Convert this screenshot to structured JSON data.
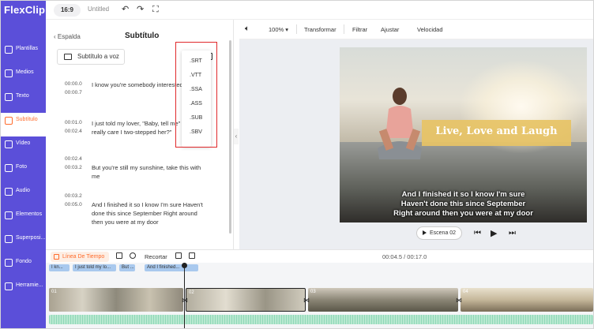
{
  "app": {
    "logo": "FlexClip"
  },
  "sidebar": {
    "items": [
      {
        "label": "Plantillas",
        "icon": "template-icon"
      },
      {
        "label": "Medios",
        "icon": "media-icon"
      },
      {
        "label": "Texto",
        "icon": "text-icon"
      },
      {
        "label": "Subtítulo",
        "icon": "subtitle-icon",
        "active": true
      },
      {
        "label": "Vídeo",
        "icon": "video-icon"
      },
      {
        "label": "Foto",
        "icon": "photo-icon"
      },
      {
        "label": "Audio",
        "icon": "audio-icon"
      },
      {
        "label": "Elementos",
        "icon": "elements-icon"
      },
      {
        "label": "Superposi...",
        "icon": "overlay-icon"
      },
      {
        "label": "Fondo",
        "icon": "background-icon"
      },
      {
        "label": "Herramie...",
        "icon": "tools-icon"
      }
    ]
  },
  "topbar": {
    "ratio": "16:9",
    "title": "Untitled"
  },
  "panel": {
    "back_label": "Espalda",
    "title": "Subtítulo",
    "tts_label": "Subtítulo a voz",
    "rows": [
      {
        "start": "00:00.0",
        "end": "00:00.7",
        "text": "I know you're somebody interested n'"
      },
      {
        "start": "00:01.0",
        "end": "00:02.4",
        "text": "I just told my lover, \"Baby, tell me\" \"Did you really care I two-stepped her?\""
      },
      {
        "start": "00:02.4",
        "end": "00:03.2",
        "text": "But you're still my sunshine, take this with me"
      },
      {
        "start": "00:03.2",
        "end": "00:05.0",
        "text": "And I finished it so I know I'm sure Haven't done this since September Right around then you were at my door"
      }
    ]
  },
  "dropdown": {
    "options": [
      ".SRT",
      ".VTT",
      ".SSA",
      ".ASS",
      ".SUB",
      ".SBV"
    ]
  },
  "toolbar": {
    "zoom": "100%",
    "transform": "Transformar",
    "filter": "Filtrar",
    "adjust": "Ajustar",
    "speed": "Velocidad"
  },
  "canvas": {
    "title_text": "Live, Love and Laugh",
    "caption_lines": [
      "And I finished it so I know I'm sure",
      "Haven't done this since September",
      "Right around then you were at my door"
    ],
    "scene_label": "Escena 02"
  },
  "timeline": {
    "label": "Línea De Tiempo",
    "crop_label": "Recortar",
    "time": "00:04.5 / 00:17.0",
    "subtitle_pills": [
      "I kn...",
      "I just told my lo...",
      "But ...",
      "And I finished..."
    ],
    "clip_numbers": [
      "01",
      "02",
      "03",
      "04"
    ]
  },
  "colors": {
    "sidebar": "#5b4fd9",
    "accent": "#ff6b2c",
    "title_box": "#e7c365",
    "highlight": "#e0292b"
  }
}
